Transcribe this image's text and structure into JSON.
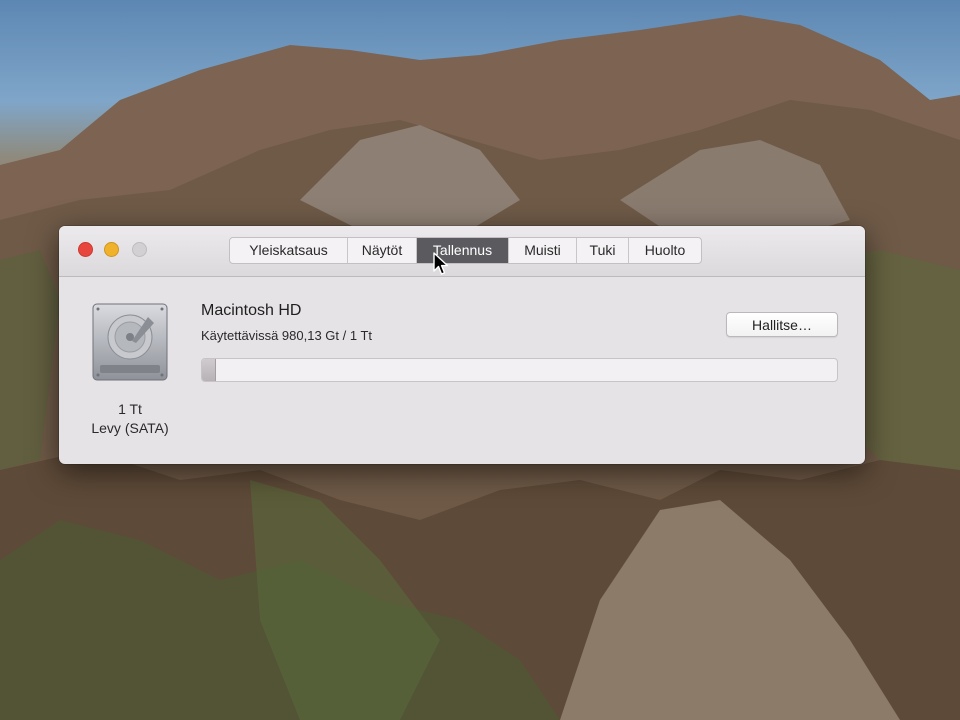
{
  "window": {
    "tabs": [
      {
        "label": "Yleiskatsaus",
        "active": false
      },
      {
        "label": "Näytöt",
        "active": false
      },
      {
        "label": "Tallennus",
        "active": true
      },
      {
        "label": "Muisti",
        "active": false
      },
      {
        "label": "Tuki",
        "active": false
      },
      {
        "label": "Huolto",
        "active": false
      }
    ]
  },
  "storage": {
    "disk_name": "Macintosh HD",
    "available": "Käytettävissä 980,13 Gt / 1 Tt",
    "capacity": "1 Tt",
    "disk_type": "Levy (SATA)",
    "manage_label": "Hallitse…",
    "used_fraction": 0.02
  },
  "colors": {
    "close": "#e8473e",
    "minimize": "#f0b22b",
    "active_tab": "#5b5a5f"
  }
}
